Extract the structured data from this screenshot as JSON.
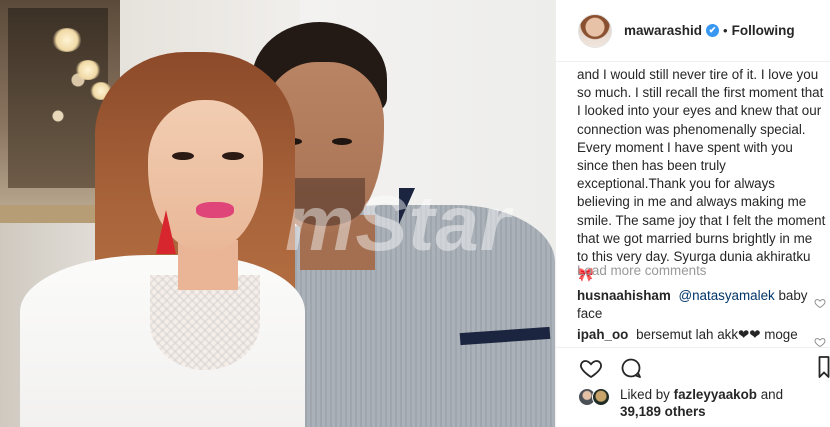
{
  "photo": {
    "watermark": "mStar"
  },
  "header": {
    "username": "mawarashid",
    "verified_mark": "✔",
    "separator": "•",
    "follow_state": "Following"
  },
  "caption": {
    "text": "and I would still never tire of it. I love you so much. I still recall the first moment that I looked into your eyes and knew that our connection was phenomenally special. Every moment I have spent with you since then has been truly exceptional.Thank you for always believing in me and always making me smile. The same joy that I felt the moment that we got married burns brightly in me to this very day. Syurga dunia akhiratku 🎀"
  },
  "load_more": "Load more comments",
  "comments": [
    {
      "user": "husnaahisham",
      "mention": "@natasyamalek",
      "text": "baby face"
    },
    {
      "user": "ipah_oo",
      "mention": "",
      "text": "bersemut lah akk❤❤ moge"
    }
  ],
  "actions": {
    "like_icon": "heart-icon",
    "comment_icon": "comment-icon",
    "save_icon": "bookmark-icon"
  },
  "likes": {
    "prefix": "Liked by",
    "liker": "fazleyyaakob",
    "connector": "and",
    "count": "39,189 others"
  },
  "colors": {
    "link": "#003569",
    "muted": "#999999",
    "verified": "#3897f0",
    "text": "#262626"
  }
}
